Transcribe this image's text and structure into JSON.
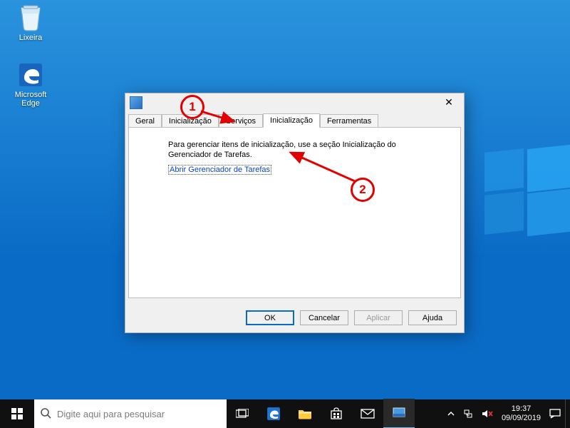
{
  "desktop": {
    "icons": {
      "recycle_label": "Lixeira",
      "edge_label": "Microsoft Edge"
    }
  },
  "dialog": {
    "tabs": {
      "general": "Geral",
      "boot": "Inicialização",
      "services": "Serviços",
      "startup": "Inicialização",
      "tools": "Ferramentas"
    },
    "message": "Para gerenciar itens de inicialização, use a seção Inicialização do Gerenciador de Tarefas.",
    "link": "Abrir Gerenciador de Tarefas",
    "buttons": {
      "ok": "OK",
      "cancel": "Cancelar",
      "apply": "Aplicar",
      "help": "Ajuda"
    }
  },
  "annotations": {
    "one": "1",
    "two": "2"
  },
  "taskbar": {
    "search_placeholder": "Digite aqui para pesquisar",
    "clock": {
      "time": "19:37",
      "date": "09/09/2019"
    }
  }
}
